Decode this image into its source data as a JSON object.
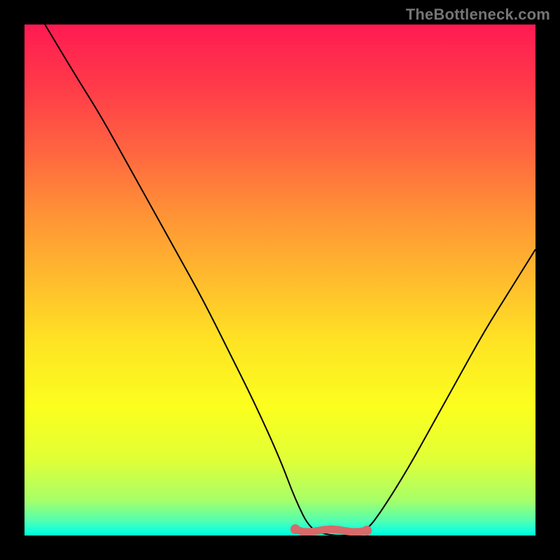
{
  "watermark": "TheBottleneck.com",
  "colors": {
    "frame": "#000000",
    "curve": "#000000",
    "optimal_band": "#d76a6a",
    "gradient_top": "#ff1a52",
    "gradient_bottom": "#00ffc9"
  },
  "chart_data": {
    "type": "line",
    "title": "",
    "xlabel": "",
    "ylabel": "",
    "xlim": [
      0,
      100
    ],
    "ylim": [
      0,
      100
    ],
    "description": "V-shaped bottleneck curve over a vertical red-to-green gradient; minimum region near x≈55–65 is highlighted.",
    "series": [
      {
        "name": "bottleneck-curve",
        "x": [
          4,
          10,
          15,
          20,
          25,
          30,
          35,
          40,
          45,
          50,
          53,
          56,
          60,
          64,
          67,
          70,
          75,
          80,
          85,
          90,
          95,
          100
        ],
        "y": [
          100,
          90,
          82,
          73,
          64,
          55,
          46,
          36,
          26,
          15,
          7,
          1,
          0,
          0,
          1,
          5,
          13,
          22,
          31,
          40,
          48,
          56
        ]
      }
    ],
    "annotations": [
      {
        "name": "optimal-range-band",
        "x_start": 53,
        "x_end": 67,
        "y": 0,
        "color": "#d76a6a"
      }
    ]
  }
}
